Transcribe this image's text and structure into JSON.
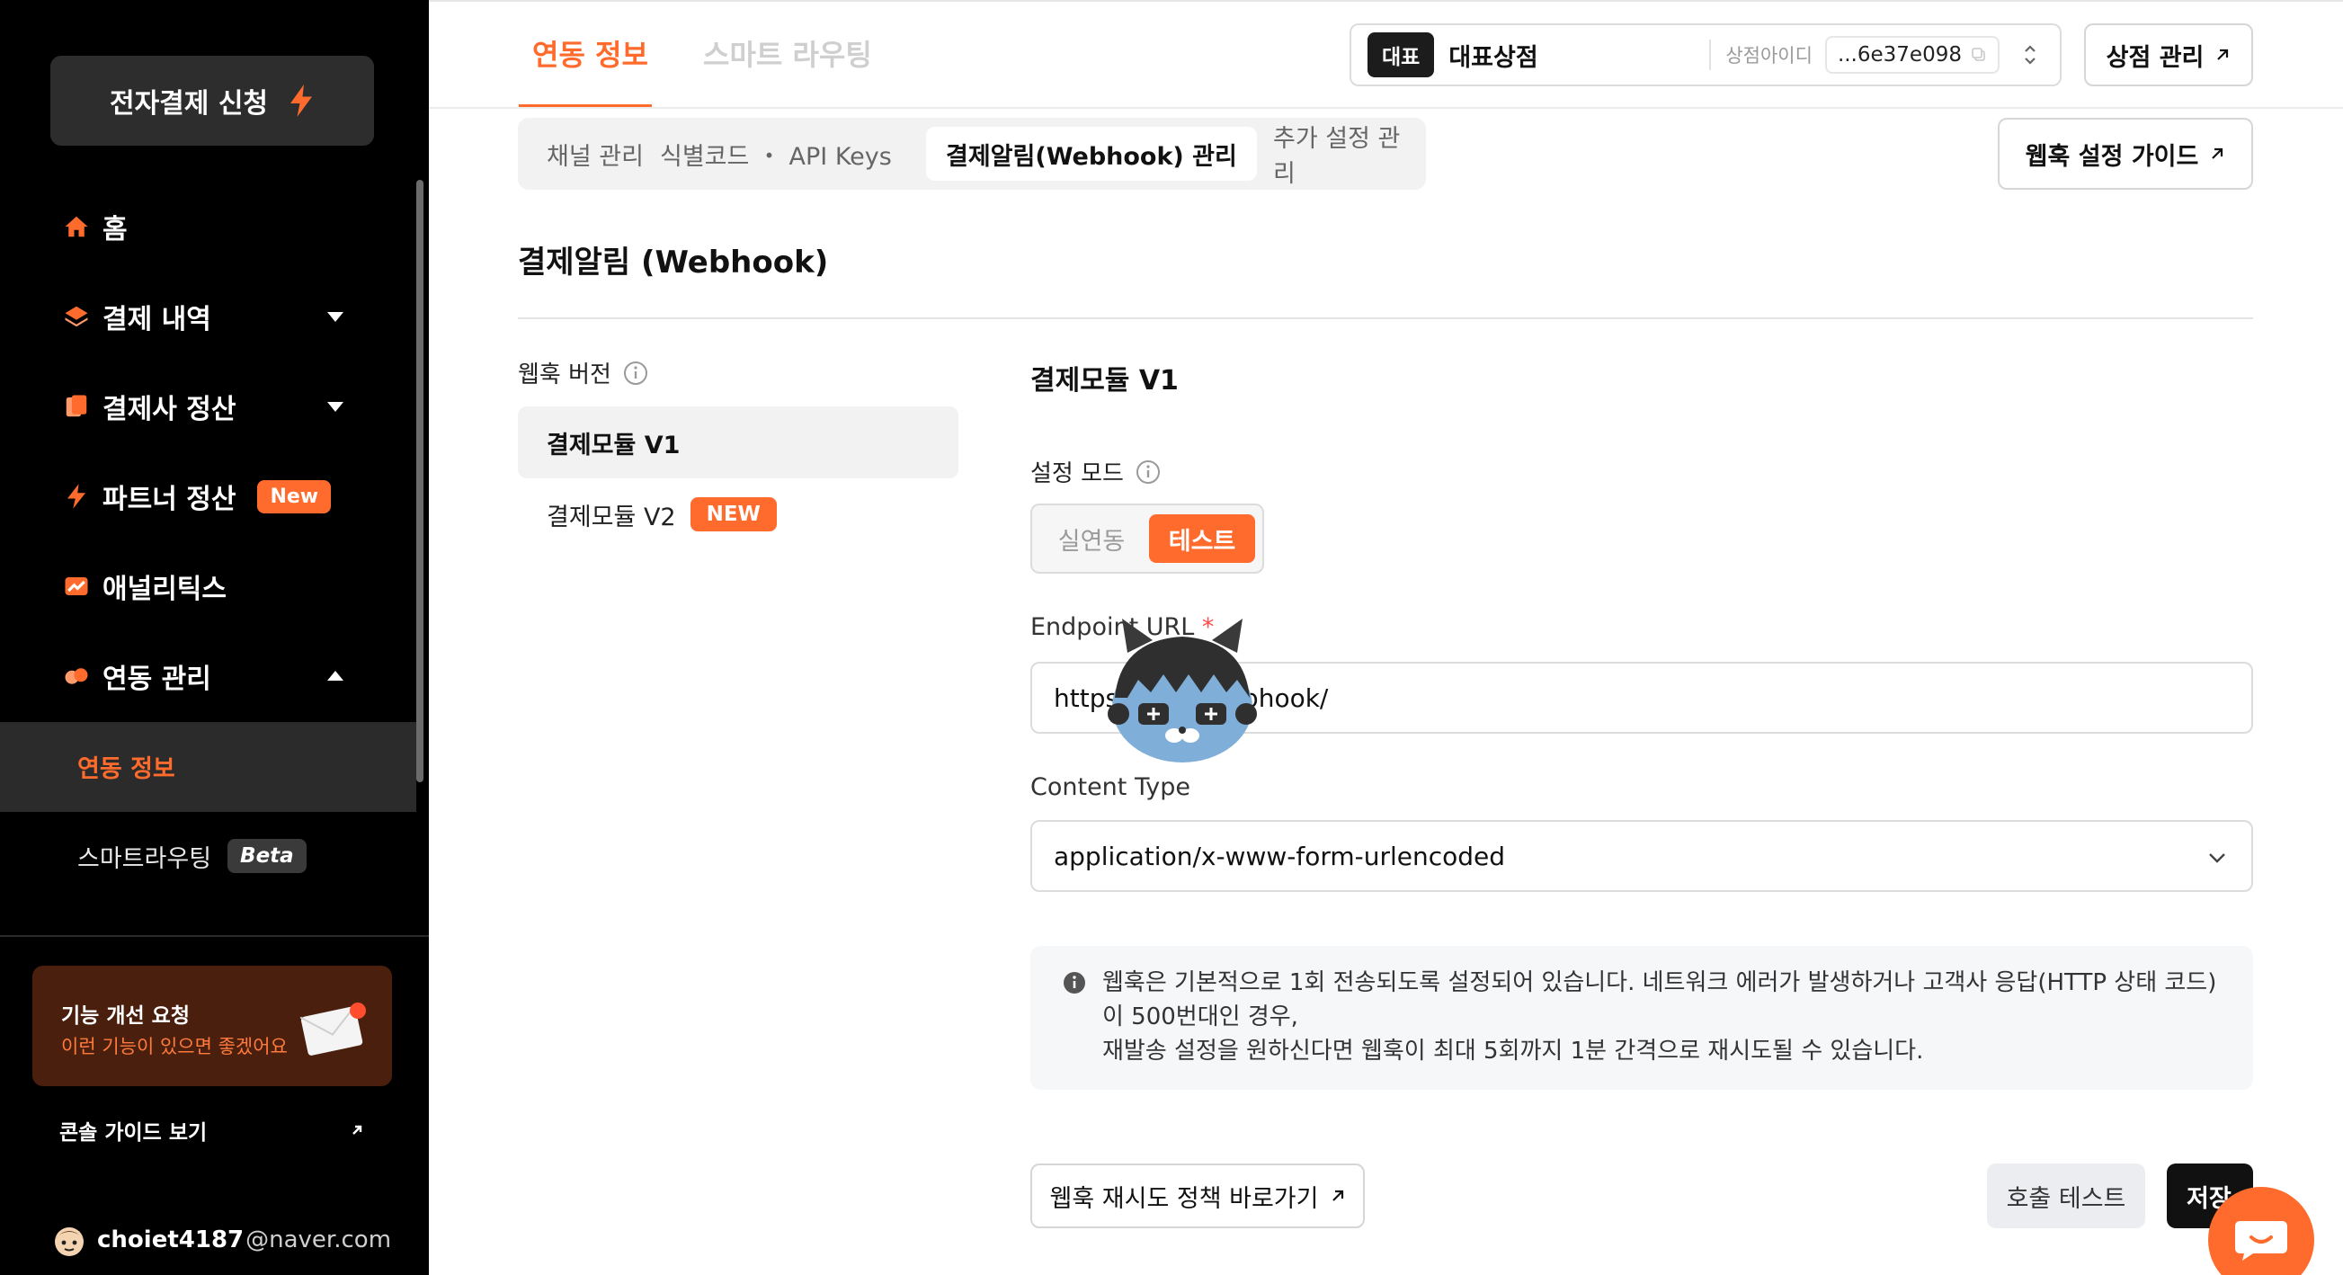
{
  "sidebar": {
    "apply_button": "전자결제 신청",
    "nav": [
      {
        "label": "홈",
        "icon": "home-icon"
      },
      {
        "label": "결제 내역",
        "icon": "layers-icon"
      },
      {
        "label": "결제사 정산",
        "icon": "documents-icon"
      },
      {
        "label": "파트너 정산",
        "icon": "bolt-icon",
        "badge": "New"
      },
      {
        "label": "애널리틱스",
        "icon": "chart-icon"
      },
      {
        "label": "연동 관리",
        "icon": "link-icon"
      }
    ],
    "sub_items": [
      {
        "label": "연동 정보"
      },
      {
        "label": "스마트라우팅",
        "badge": "Beta"
      }
    ],
    "feedback": {
      "title": "기능 개선 요청",
      "subtitle": "이런 기능이 있으면 좋겠어요"
    },
    "guide_link": "콘솔 가이드 보기",
    "user": {
      "name": "choiet4187",
      "domain": "@naver.com"
    }
  },
  "header": {
    "tabs": [
      {
        "label": "연동 정보",
        "active": true
      },
      {
        "label": "스마트 라우팅",
        "active": false
      }
    ],
    "store": {
      "tag": "대표",
      "name": "대표상점",
      "id_label": "상점아이디",
      "id_value": "...6e37e098"
    },
    "store_manage": "상점 관리"
  },
  "subtabs": [
    {
      "label": "채널 관리"
    },
    {
      "label": "식별코드 ・ API Keys"
    },
    {
      "label": "결제알림(Webhook) 관리",
      "active": true
    },
    {
      "label": "추가 설정 관리"
    }
  ],
  "guide_button": "웹훅 설정 가이드",
  "page_title": "결제알림 (Webhook)",
  "version_section": {
    "label": "웹훅 버전",
    "items": [
      {
        "label": "결제모듈 V1",
        "active": true
      },
      {
        "label": "결제모듈 V2",
        "badge": "NEW"
      }
    ]
  },
  "module": {
    "title": "결제모듈 V1",
    "mode_label": "설정 모드",
    "mode_options": [
      "실연동",
      "테스트"
    ],
    "mode_selected": "테스트",
    "endpoint_label": "Endpoint URL",
    "endpoint_required": "*",
    "endpoint_value": "https://mall/webhook/",
    "content_type_label": "Content Type",
    "content_type_value": "application/x-www-form-urlencoded",
    "notice_lines": [
      "웹훅은 기본적으로 1회 전송되도록 설정되어 있습니다. 네트워크 에러가 발생하거나 고객사 응답(HTTP 상태 코드)",
      "이 500번대인 경우,",
      "재발송 설정을 원하신다면 웹훅이 최대 5회까지 1분 간격으로 재시도될 수 있습니다."
    ],
    "policy_button": "웹훅 재시도 정책 바로가기",
    "test_button": "호출 테스트",
    "save_button": "저장"
  },
  "colors": {
    "accent": "#ff6b2c",
    "sidebar_bg": "#000000"
  }
}
